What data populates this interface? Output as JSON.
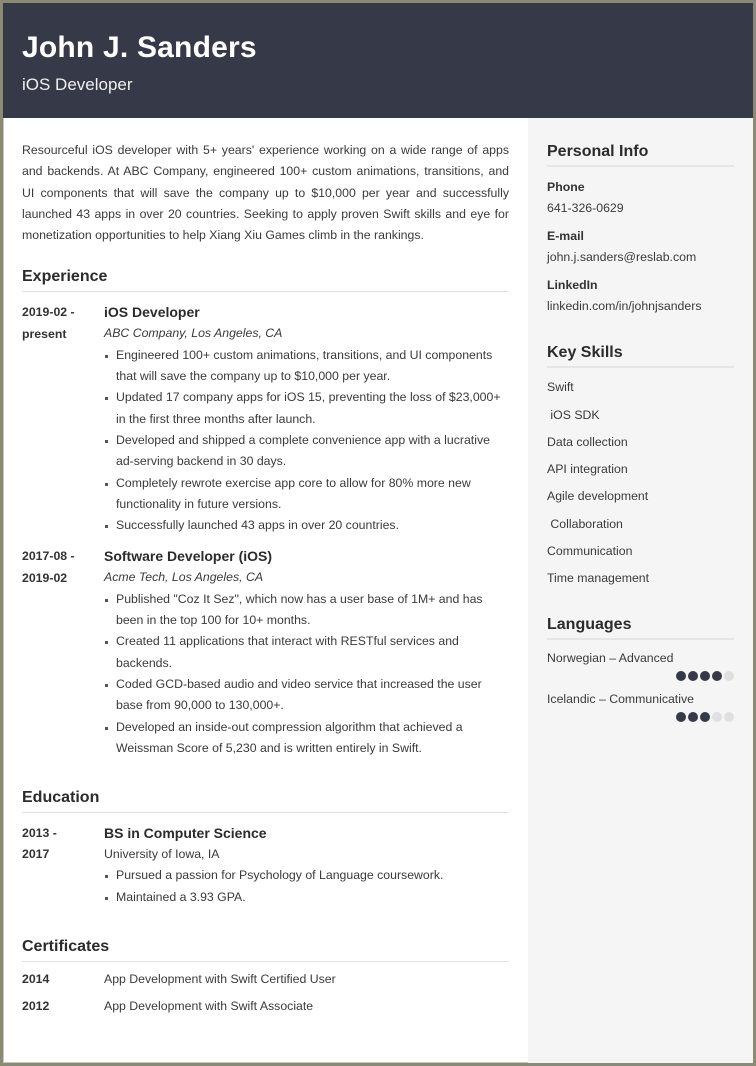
{
  "header": {
    "name": "John J. Sanders",
    "title": "iOS Developer"
  },
  "summary": "Resourceful iOS developer with 5+ years' experience working on a wide range of apps and backends. At ABC Company, engineered 100+ custom animations, transitions, and UI components that will save the company up to $10,000 per year and successfully launched 43 apps in over 20 countries. Seeking to apply proven Swift skills and eye for monetization opportunities to help Xiang Xiu Games climb in the rankings.",
  "experience": {
    "title": "Experience",
    "entries": [
      {
        "date_start": "2019-02 -",
        "date_end": "present",
        "role": "iOS Developer",
        "org": "ABC Company, Los Angeles, CA",
        "bullets": [
          "Engineered 100+ custom animations, transitions, and UI components that will save the company up to $10,000 per year.",
          "Updated 17 company apps for iOS 15, preventing the loss of $23,000+ in the first three months after launch.",
          "Developed and shipped a complete convenience app with a lucrative ad-serving backend in 30 days.",
          "Completely rewrote exercise app core to allow for 80% more new functionality in future versions.",
          "Successfully launched 43 apps in over 20 countries."
        ]
      },
      {
        "date_start": "2017-08 -",
        "date_end": "2019-02",
        "role": "Software Developer (iOS)",
        "org": "Acme Tech, Los Angeles, CA",
        "bullets": [
          "Published \"Coz It Sez\", which now has a user base of 1M+ and has been in the top 100 for 10+ months.",
          "Created 11 applications that interact with RESTful services and backends.",
          "Coded GCD-based audio and video service that increased the user base from 90,000 to 130,000+.",
          "Developed an inside-out compression algorithm that achieved a Weissman Score of 5,230 and is written entirely in Swift."
        ]
      }
    ]
  },
  "education": {
    "title": "Education",
    "entries": [
      {
        "date_start": "2013 -",
        "date_end": "2017",
        "degree": "BS in Computer Science",
        "school": "University of Iowa, IA",
        "bullets": [
          "Pursued a passion for Psychology of Language coursework.",
          "Maintained a 3.93 GPA."
        ]
      }
    ]
  },
  "certificates": {
    "title": "Certificates",
    "items": [
      {
        "year": "2014",
        "name": "App Development with Swift Certified User"
      },
      {
        "year": "2012",
        "name": "App Development with Swift Associate"
      }
    ]
  },
  "sidebar": {
    "personal_info": {
      "title": "Personal Info",
      "fields": [
        {
          "label": "Phone",
          "value": "641-326-0629"
        },
        {
          "label": "E-mail",
          "value": "john.j.sanders@reslab.com"
        },
        {
          "label": "LinkedIn",
          "value": "linkedin.com/in/johnjsanders"
        }
      ]
    },
    "skills": {
      "title": "Key Skills",
      "items": [
        "Swift",
        " iOS SDK",
        "Data collection",
        "API integration",
        "Agile development",
        " Collaboration",
        "Communication",
        "Time management"
      ]
    },
    "languages": {
      "title": "Languages",
      "items": [
        {
          "label": "Norwegian – Advanced",
          "level": 4,
          "max": 5
        },
        {
          "label": "Icelandic – Communicative",
          "level": 3,
          "max": 5
        }
      ]
    }
  },
  "colors": {
    "header_bg": "#363a48",
    "sidebar_bg": "#f5f5f5",
    "dot_filled": "#363a48",
    "dot_empty": "#e0e0e0",
    "frame_border": "#8b8a74"
  }
}
